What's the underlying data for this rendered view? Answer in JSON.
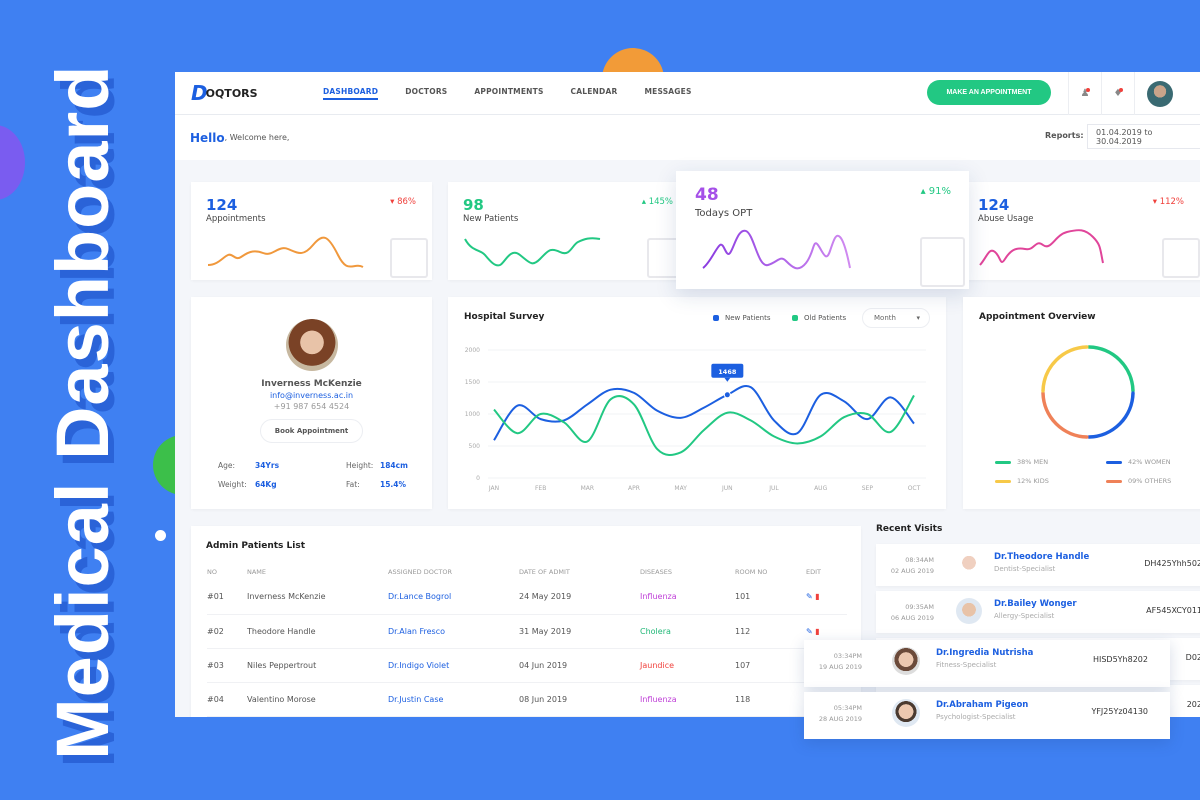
{
  "title": "Medical Dashboard",
  "colors": {
    "background": "#3f80f2",
    "brand": "#1c5fe0",
    "green": "#22c883",
    "orange": "#f0983c",
    "purple": "#a550e8",
    "pink": "#e0459a",
    "red": "#f0413c"
  },
  "nav": {
    "logo": "OQTORS",
    "logo_mark": "D",
    "links": [
      "DASHBOARD",
      "DOCTORS",
      "APPOINTMENTS",
      "CALENDAR",
      "MESSAGES"
    ],
    "active": "DASHBOARD",
    "cta": "MAKE AN APPOINTMENT",
    "icons": [
      "user-alert-icon",
      "bell-icon",
      "avatar"
    ]
  },
  "greeting": {
    "hello": "Hello",
    "welcome": ", Welcome here,",
    "reports_label": "Reports:",
    "date_range": "01.04.2019 to 30.04.2019"
  },
  "stats": [
    {
      "value": "124",
      "label": "Appointments",
      "change": "86%",
      "trend": "down",
      "color": "#1c5fe0",
      "pct_color": "#f0413c"
    },
    {
      "value": "98",
      "label": "New Patients",
      "change": "145%",
      "trend": "up",
      "color": "#22c883",
      "pct_color": "#22c883"
    },
    {
      "value": "48",
      "label": "Todays OPT",
      "change": "91%",
      "trend": "up",
      "color": "#a550e8",
      "pct_color": "#22c883"
    },
    {
      "value": "124",
      "label": "Abuse Usage",
      "change": "112%",
      "trend": "down",
      "color": "#1c5fe0",
      "pct_color": "#f0413c"
    }
  ],
  "profile": {
    "name": "Inverness McKenzie",
    "email": "info@inverness.ac.in",
    "phone": "+91 987 654 4524",
    "button": "Book Appointment",
    "fields": [
      {
        "k": "Age:",
        "v": "34Yrs"
      },
      {
        "k": "Height:",
        "v": "184cm"
      },
      {
        "k": "Weight:",
        "v": "64Kg"
      },
      {
        "k": "Fat:",
        "v": "15.4%"
      }
    ]
  },
  "chart_data": [
    {
      "type": "line",
      "title": "Hospital Survey",
      "period_select": "Month",
      "legend_placement": "top-right",
      "grid": true,
      "categories": [
        "JAN",
        "FEB",
        "MAR",
        "APR",
        "MAY",
        "JUN",
        "JUL",
        "AUG",
        "SEP",
        "OCT"
      ],
      "yticks": [
        "0",
        "500",
        "1000",
        "1500",
        "2000"
      ],
      "ylim": [
        0,
        2000
      ],
      "x": [
        1,
        1.5,
        2,
        2.5,
        3,
        3.5,
        4,
        4.5,
        5,
        5.5,
        6,
        6.5,
        7,
        7.5,
        8,
        8.5,
        9,
        9.5,
        10
      ],
      "series": [
        {
          "name": "New Patients",
          "color": "#1c5fe0",
          "values": [
            590,
            1130,
            920,
            900,
            1150,
            1380,
            1330,
            1050,
            940,
            1100,
            1300,
            1420,
            900,
            700,
            1300,
            1200,
            920,
            1260,
            850
          ]
        },
        {
          "name": "Old Patients",
          "color": "#22c883",
          "values": [
            1070,
            700,
            1000,
            870,
            570,
            1230,
            1150,
            450,
            400,
            750,
            1020,
            900,
            650,
            540,
            650,
            950,
            1000,
            720,
            1290
          ]
        }
      ],
      "annotation": {
        "label": "1468",
        "series": "New Patients",
        "x": 6
      }
    },
    {
      "type": "pie",
      "title": "Appointment Overview",
      "categories": [
        "MEN",
        "WOMEN",
        "KIDS",
        "OTHERS"
      ],
      "labels": [
        "38% MEN",
        "42% WOMEN",
        "12% KIDS",
        "09% OTHERS"
      ],
      "values": [
        38,
        42,
        12,
        9
      ],
      "colors": [
        "#22c883",
        "#1c5fe0",
        "#f7c948",
        "#ef8158"
      ]
    }
  ],
  "patients": {
    "title": "Admin Patients List",
    "columns": [
      "NO",
      "NAME",
      "ASSIGNED DOCTOR",
      "DATE OF ADMIT",
      "DISEASES",
      "ROOM NO",
      "EDIT"
    ],
    "rows": [
      {
        "no": "#01",
        "name": "Inverness McKenzie",
        "doctor": "Dr.Lance Bogrol",
        "date": "24 May 2019",
        "disease": "Influenza",
        "dcolor": "#c040d8",
        "room": "101"
      },
      {
        "no": "#02",
        "name": "Theodore Handle",
        "doctor": "Dr.Alan Fresco",
        "date": "31 May 2019",
        "disease": "Cholera",
        "dcolor": "#22b878",
        "room": "112"
      },
      {
        "no": "#03",
        "name": "Niles Peppertrout",
        "doctor": "Dr.Indigo Violet",
        "date": "04 Jun 2019",
        "disease": "Jaundice",
        "dcolor": "#f0413c",
        "room": "107"
      },
      {
        "no": "#04",
        "name": "Valentino Morose",
        "doctor": "Dr.Justin Case",
        "date": "08 Jun 2019",
        "disease": "Influenza",
        "dcolor": "#c040d8",
        "room": "118"
      }
    ]
  },
  "visits": {
    "title": "Recent Visits",
    "items": [
      {
        "time": "08:34AM",
        "date": "02 AUG 2019",
        "name": "Dr.Theodore Handle",
        "spec": "Dentist-Specialist",
        "code": "DH425Yhh502"
      },
      {
        "time": "09:35AM",
        "date": "06 AUG 2019",
        "name": "Dr.Bailey Wonger",
        "spec": "Allergy-Specialist",
        "code": "AF545XCY011"
      },
      {
        "time": "03:34PM",
        "date": "19 AUG 2019",
        "name": "Dr.Ingredia Nutrisha",
        "spec": "Fitness-Specialist",
        "code": "HISD5Yh8202"
      },
      {
        "time": "05:34PM",
        "date": "28 AUG 2019",
        "name": "Dr.Abraham Pigeon",
        "spec": "Psychologist-Specialist",
        "code": "YFJ25Yz04130"
      }
    ],
    "hidden_codes": [
      "D02",
      "202"
    ]
  }
}
